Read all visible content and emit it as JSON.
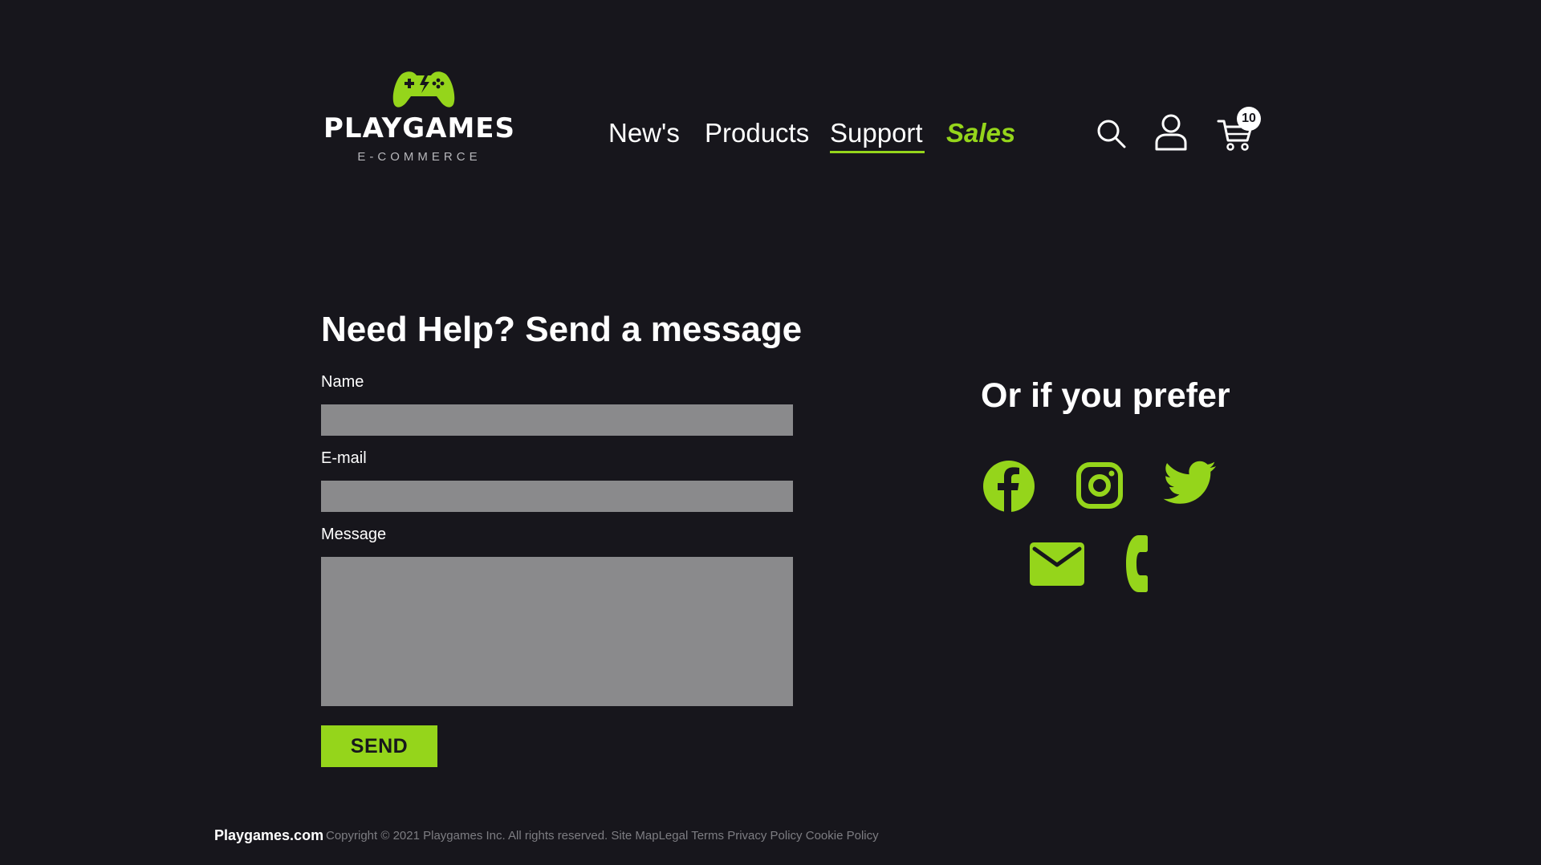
{
  "brand": {
    "name": "PLAYGAMES",
    "tagline": "E-COMMERCE"
  },
  "nav": {
    "items": [
      {
        "label": "New's"
      },
      {
        "label": "Products"
      },
      {
        "label": "Support"
      },
      {
        "label": "Sales"
      }
    ],
    "active": "Support"
  },
  "header_icons": {
    "search": "search-icon",
    "account": "user-icon",
    "cart": "cart-icon",
    "cart_count": "10"
  },
  "form": {
    "title": "Need Help? Send a message",
    "fields": [
      {
        "label": "Name",
        "value": "",
        "placeholder": ""
      },
      {
        "label": "E-mail",
        "value": "",
        "placeholder": ""
      },
      {
        "label": "Message",
        "value": "",
        "placeholder": ""
      }
    ],
    "submit_label": "SEND"
  },
  "contact": {
    "title": "Or if you prefer",
    "channels": [
      "facebook-icon",
      "instagram-icon",
      "twitter-icon",
      "mail-icon",
      "phone-icon"
    ]
  },
  "footer": {
    "brand": "Playgames.com",
    "copyright": "Copyright © 2021 Playgames Inc. All rights reserved.",
    "links": [
      "Site Map",
      "Legal Terms",
      "Privacy Policy",
      "Cookie Policy"
    ]
  },
  "colors": {
    "background": "#17161c",
    "accent": "#95d51b",
    "field": "#8a8a8c",
    "muted_text": "#7d7d82"
  }
}
